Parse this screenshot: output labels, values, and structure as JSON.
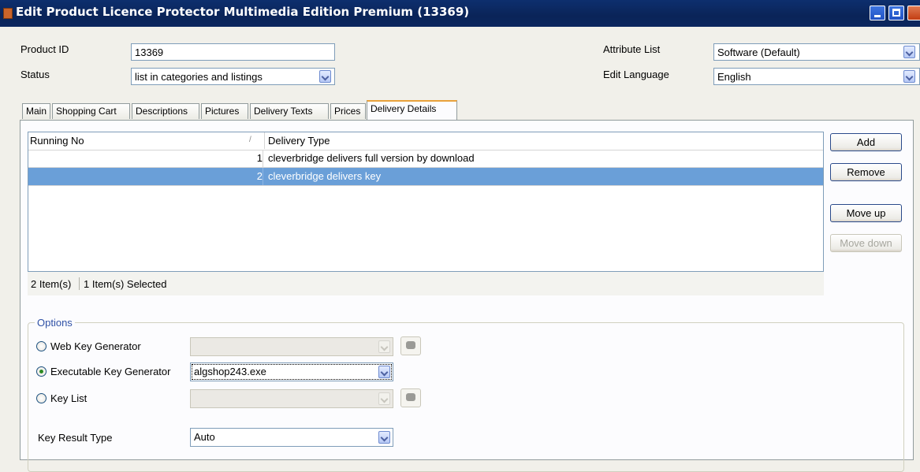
{
  "window": {
    "title": "Edit Product Licence Protector Multimedia Edition Premium (13369)"
  },
  "header": {
    "product_id_label": "Product ID",
    "product_id_value": "13369",
    "status_label": "Status",
    "status_value": "list in categories and listings",
    "attribute_list_label": "Attribute List",
    "attribute_list_value": "Software (Default)",
    "edit_language_label": "Edit Language",
    "edit_language_value": "English"
  },
  "tabs": [
    {
      "label": "Main"
    },
    {
      "label": "Shopping Cart"
    },
    {
      "label": "Descriptions"
    },
    {
      "label": "Pictures"
    },
    {
      "label": "Delivery Texts"
    },
    {
      "label": "Prices"
    },
    {
      "label": "Delivery Details",
      "active": true
    }
  ],
  "list": {
    "columns": [
      "Running No",
      "Delivery Type"
    ],
    "sort_icon": "/",
    "rows": [
      {
        "no": "1",
        "type": "cleverbridge delivers full version by download",
        "selected": false
      },
      {
        "no": "2",
        "type": "cleverbridge delivers key",
        "selected": true
      }
    ],
    "status_count": "2 Item(s)",
    "status_selected": "1 Item(s) Selected"
  },
  "buttons": {
    "add": "Add",
    "remove": "Remove",
    "move_up": "Move up",
    "move_down": "Move down"
  },
  "options": {
    "title": "Options",
    "web_key_generator": "Web Key Generator",
    "executable_key_generator": "Executable Key Generator",
    "executable_value": "algshop243.exe",
    "key_list": "Key List",
    "key_result_type_label": "Key Result Type",
    "key_result_type_value": "Auto",
    "selected_option": "executable_key_generator"
  }
}
